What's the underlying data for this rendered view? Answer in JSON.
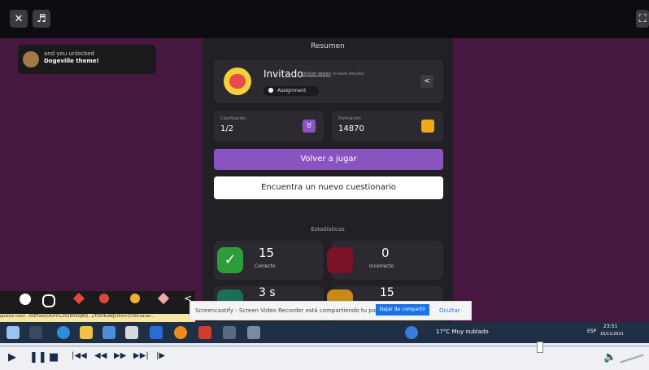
{
  "unlock": {
    "line1": "and you unlocked",
    "line2": "Dogeville theme!"
  },
  "panel": {
    "title": "Resumen",
    "user": {
      "name": "Invitado",
      "login_link": "(Iniciar sesión",
      "login_rest": "to save results)",
      "badge": "Assignment"
    },
    "stats_row": {
      "left_label": "Clasificación",
      "left_value": "1/2",
      "right_label": "Puntuación",
      "right_value": "14870"
    },
    "play_again": "Volver a jugar",
    "new_quiz": "Encuentra un nuevo cuestionario",
    "stats_title": "Estadísticas",
    "correct": {
      "value": "15",
      "label": "Correcto"
    },
    "incorrect": {
      "value": "0",
      "label": "Incorrecto"
    },
    "time": {
      "value": "3 s"
    },
    "streak": {
      "value": "15"
    }
  },
  "url_fragment": "quizizz.com/...IOZFxeQUiUrYrL2528IYk0JRQ...yTQiVboWJ/nSlo=/COttuiaver...",
  "screencastify": {
    "message": "Screencastify - Screen Video Recorder está compartiendo tu pantalla.",
    "stop": "Dejar de compartir",
    "hide": "Ocultar"
  },
  "taskbar": {
    "weather": "17°C Muy nublado",
    "lang": "ESP",
    "time": "23:51",
    "date": "16/11/2021"
  },
  "colors": {
    "accent": "#8854c0",
    "correct": "#2d9d3a",
    "incorrect": "#ec0b43",
    "dark": "#221f25"
  }
}
